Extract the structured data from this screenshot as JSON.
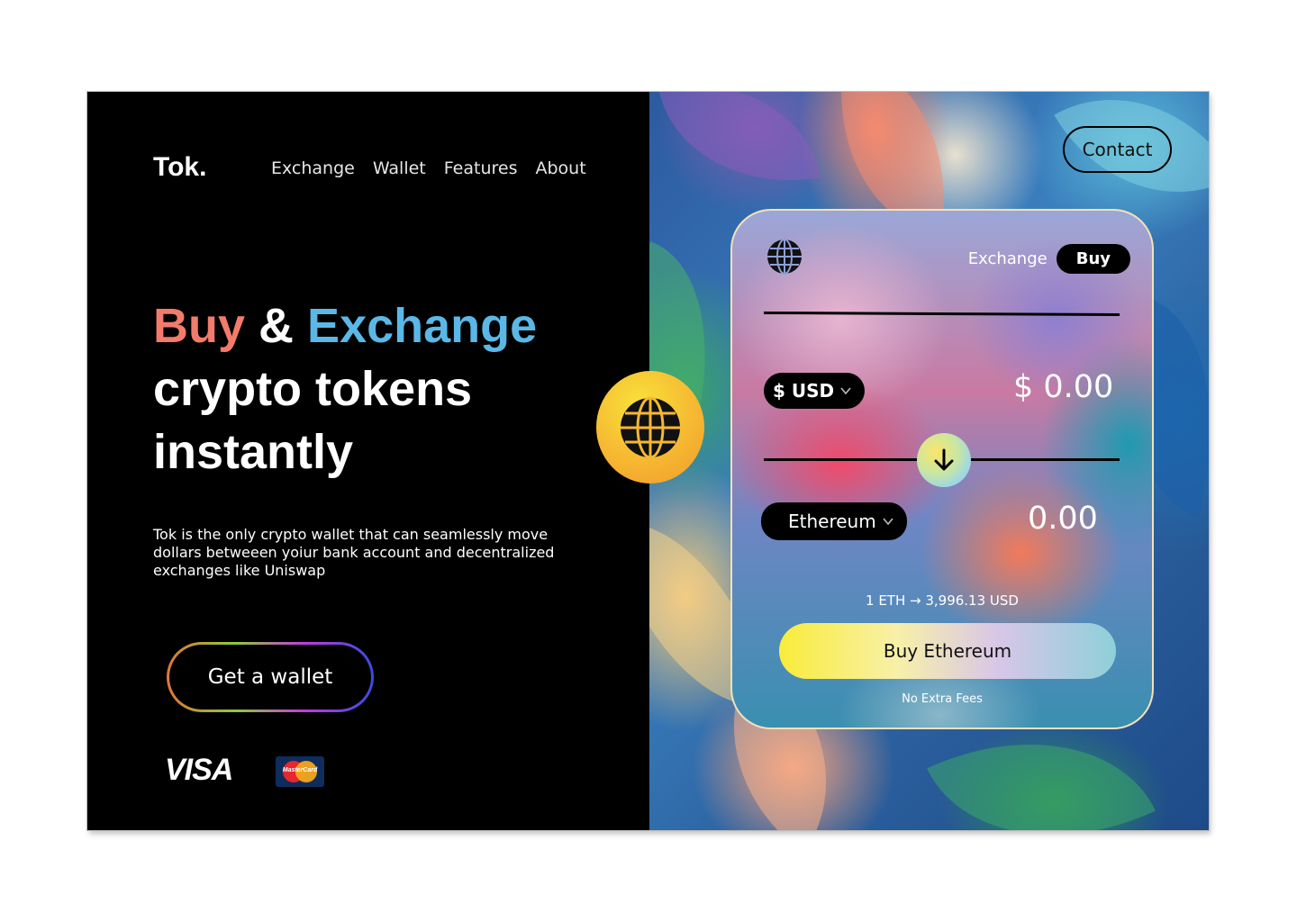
{
  "brand": {
    "logo": "Tok."
  },
  "nav": {
    "items": [
      "Exchange",
      "Wallet",
      "Features",
      "About"
    ],
    "contact": "Contact"
  },
  "hero": {
    "word_buy": "Buy",
    "amp": "&",
    "word_exchange": "Exchange",
    "line2": "crypto tokens",
    "line3": "instantly",
    "description": "Tok is the only crypto wallet that can seamlessly move dollars betweeen yoiur bank account and decentralized exchanges like Uniswap",
    "cta": "Get a wallet"
  },
  "payments": {
    "visa": "VISA",
    "mastercard": "MasterCard"
  },
  "widget": {
    "tab_exchange": "Exchange",
    "tab_buy": "Buy",
    "from_currency": "$ USD",
    "from_amount": "$ 0.00",
    "to_currency": "Ethereum",
    "to_amount": "0.00",
    "rate": "1 ETH → 3,996.13 USD",
    "buy_button": "Buy Ethereum",
    "fees_note": "No Extra Fees"
  },
  "colors": {
    "accent_buy": "#f27b6b",
    "accent_exchange": "#5ab8e6",
    "badge_yellow": "#f6b832"
  }
}
